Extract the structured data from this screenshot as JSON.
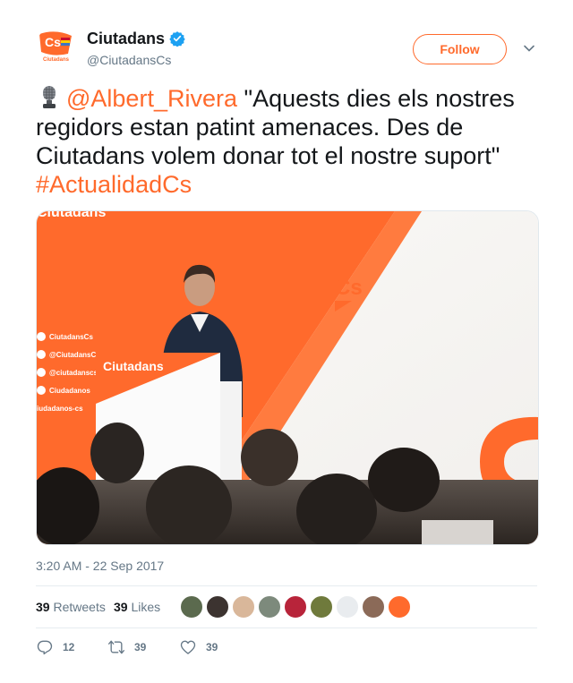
{
  "user": {
    "name": "Ciutadans",
    "handle": "@CiutadansCs",
    "verified_icon": "verified-badge-icon",
    "avatar_text": "Cs",
    "avatar_subtext": "Ciutadans",
    "follow_label": "Follow"
  },
  "tweet": {
    "mention": "@Albert_Rivera",
    "quote": " \"Aquests dies els nostres regidors estan patint amenaces. Des de Ciutadans volem donar tot el nostre suport\"",
    "hashtag": "#ActualidadCs",
    "emoji_icon": "microphone-icon"
  },
  "media": {
    "banner_top": "Ciutadans",
    "podium_label": "Ciutadans",
    "wall_logo": "Cs",
    "social_items": [
      "CiutadansCs",
      "@CiutadansC",
      "@ciutadanscs",
      "Ciudadanos",
      "iudadanos-cs"
    ]
  },
  "timestamp": "3:20 AM - 22 Sep 2017",
  "stats": {
    "retweets_count": "39",
    "retweets_label": "Retweets",
    "likes_count": "39",
    "likes_label": "Likes"
  },
  "actions": {
    "reply_count": "12",
    "retweet_count": "39",
    "like_count": "39"
  },
  "colors": {
    "brand": "#ff6a2c",
    "text": "#14171a",
    "muted": "#657786",
    "verified": "#1da1f2"
  }
}
